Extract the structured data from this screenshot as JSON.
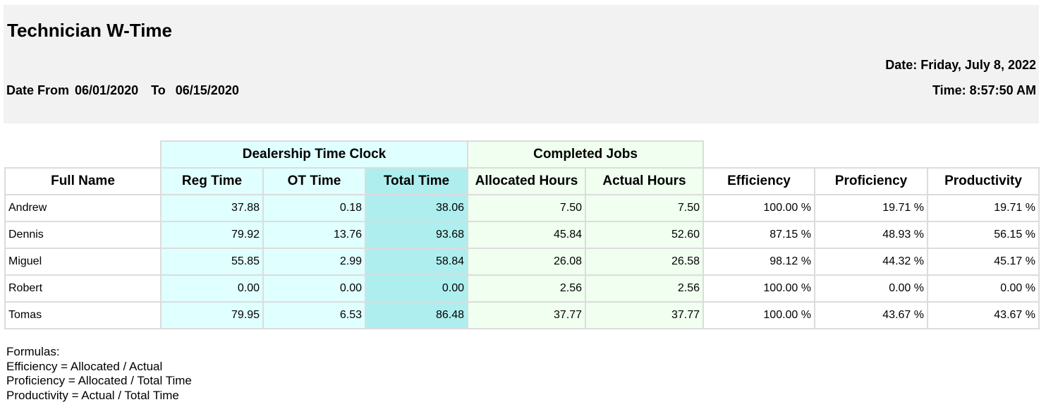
{
  "report": {
    "title": "Technician W-Time",
    "date_from_label": "Date From",
    "date_from": "06/01/2020",
    "to_label": "To",
    "date_to": "06/15/2020",
    "run_date": "Date: Friday, July 8, 2022",
    "run_time": "Time: 8:57:50 AM"
  },
  "table": {
    "groups": {
      "time_clock": "Dealership Time Clock",
      "completed_jobs": "Completed Jobs"
    },
    "columns": [
      "Full Name",
      "Reg Time",
      "OT Time",
      "Total Time",
      "Allocated Hours",
      "Actual Hours",
      "Efficiency",
      "Proficiency",
      "Productivity"
    ],
    "rows": [
      [
        "Andrew",
        "37.88",
        "0.18",
        "38.06",
        "7.50",
        "7.50",
        "100.00 %",
        "19.71 %",
        "19.71 %"
      ],
      [
        "Dennis",
        "79.92",
        "13.76",
        "93.68",
        "45.84",
        "52.60",
        "87.15 %",
        "48.93 %",
        "56.15 %"
      ],
      [
        "Miguel",
        "55.85",
        "2.99",
        "58.84",
        "26.08",
        "26.58",
        "98.12 %",
        "44.32 %",
        "45.17 %"
      ],
      [
        "Robert",
        "0.00",
        "0.00",
        "0.00",
        "2.56",
        "2.56",
        "100.00 %",
        "0.00 %",
        "0.00 %"
      ],
      [
        "Tomas",
        "79.95",
        "6.53",
        "86.48",
        "37.77",
        "37.77",
        "100.00 %",
        "43.67 %",
        "43.67 %"
      ]
    ]
  },
  "formulas": {
    "heading": "Formulas:",
    "lines": [
      "Efficiency = Allocated / Actual",
      "Proficiency = Allocated / Total Time",
      "Productivity = Actual / Total Time"
    ]
  },
  "colors": {
    "header_bg": "#f2f2f2",
    "time_clock_bg": "#e0ffff",
    "total_time_bg": "#afeeee",
    "completed_jobs_bg": "#f0fff0",
    "grid_line": "#dcdcdc"
  }
}
